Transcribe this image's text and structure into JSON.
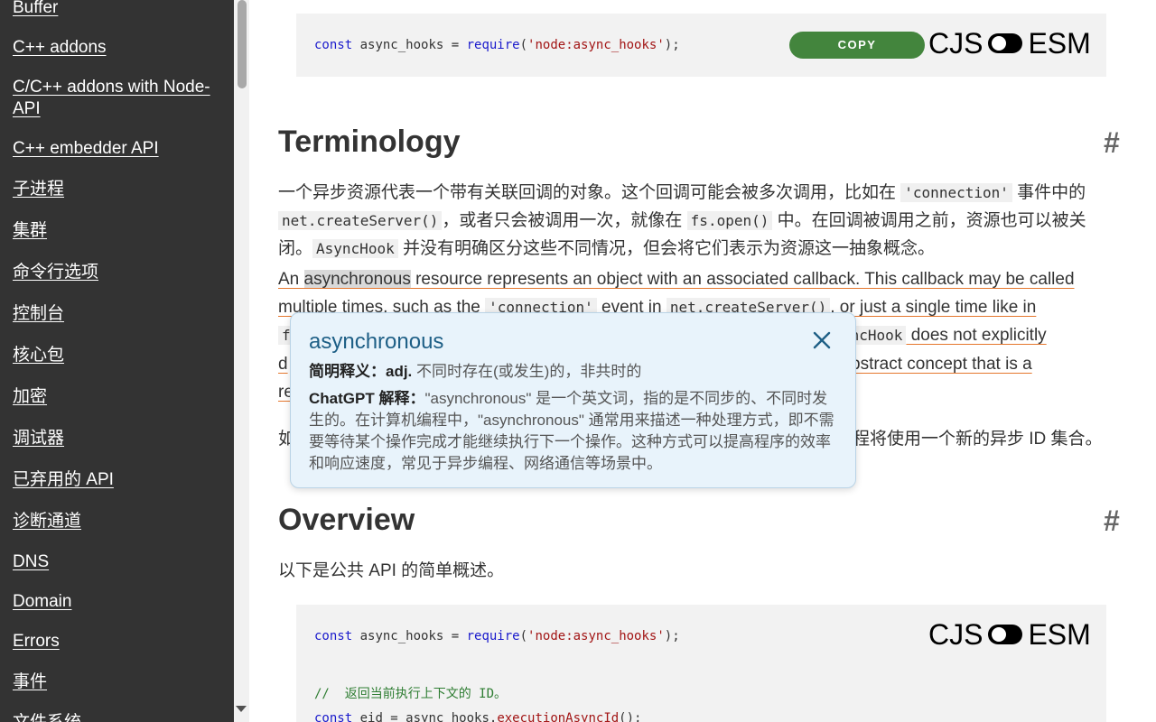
{
  "sidebar": {
    "items": [
      {
        "label": "Buffer"
      },
      {
        "label": "C++ addons"
      },
      {
        "label": "C/C++ addons with Node-API"
      },
      {
        "label": "C++ embedder API"
      },
      {
        "label": "子进程"
      },
      {
        "label": "集群"
      },
      {
        "label": "命令行选项"
      },
      {
        "label": "控制台"
      },
      {
        "label": "核心包"
      },
      {
        "label": "加密"
      },
      {
        "label": "调试器"
      },
      {
        "label": "已弃用的 API"
      },
      {
        "label": "诊断通道"
      },
      {
        "label": "DNS"
      },
      {
        "label": "Domain"
      },
      {
        "label": "Errors"
      },
      {
        "label": "事件"
      },
      {
        "label": "文件系统"
      }
    ]
  },
  "code1": {
    "kw": "const",
    "var": " async_hooks = ",
    "fn": "require",
    "open": "(",
    "str": "'node:async_hooks'",
    "close": ");",
    "copy_label": "COPY",
    "cjs": "CJS",
    "esm": "ESM"
  },
  "terminology": {
    "title": "Terminology",
    "anchor": "#",
    "zh_1": "一个异步资源代表一个带有关联回调的对象。这个回调可能会被多次调用，比如在 ",
    "zh_code1": "'connection'",
    "zh_2": " 事件中的",
    "zh_code2": "net.createServer()",
    "zh_3": "，或者只会被调用一次，就像在 ",
    "zh_code3": "fs.open()",
    "zh_4": " 中。在回调被调用之前，资源也可以被关",
    "zh_5": "闭。",
    "zh_code4": "AsyncHook",
    "zh_6": " 并没有明确区分这些不同情况，但会将它们表示为资源这一抽象概念。",
    "en_1a": "An ",
    "en_hl": "asynchronous",
    "en_1b": " resource represents an object with an associated callback. This callback may be called",
    "en_2a": "multiple times, such as the ",
    "en_2code": "'connection'",
    "en_2b": " event in ",
    "en_2code2": "net.createServer()",
    "en_2c": ", or just a single time like in",
    "en_3a": "f",
    "en_3code": "yncHook",
    "en_3b": " does not explicitly",
    "en_4a": "d",
    "en_4b": "bstract concept that is a",
    "en_5a": "re",
    "zh_last_a": "如",
    "zh_last_b": "程将使用一个新的异步 ID 集合。"
  },
  "popup": {
    "word": "asynchronous",
    "def_label": "简明释义：",
    "def_pos": "adj.",
    "def_text": " 不同时存在(或发生)的，非共时的",
    "gpt_label": "ChatGPT 解释：",
    "gpt_text": "\"asynchronous\" 是一个英文词，指的是不同步的、不同时发生的。在计算机编程中，\"asynchronous\" 通常用来描述一种处理方式，即不需要等待某个操作完成才能继续执行下一个操作。这种方式可以提高程序的效率和响应速度，常见于异步编程、网络通信等场景中。"
  },
  "overview": {
    "title": "Overview",
    "anchor": "#",
    "intro": "以下是公共 API 的简单概述。"
  },
  "code2": {
    "kw": "const",
    "var": " async_hooks = ",
    "fn": "require",
    "open": "(",
    "str": "'node:async_hooks'",
    "close": ");",
    "comment": "//  返回当前执行上下文的 ID。",
    "line3_kw": "const",
    "line3_var": " eid = async_hooks.",
    "line3_fn": "executionAsyncId",
    "line3_end": "();",
    "cjs": "CJS",
    "esm": "ESM"
  },
  "colors": {
    "sidebar_bg": "#333333",
    "copy_button": "#43853d",
    "popup_bg": "#e8f3fb",
    "popup_word": "#1e5f86",
    "link_underline": "#e5772e"
  }
}
